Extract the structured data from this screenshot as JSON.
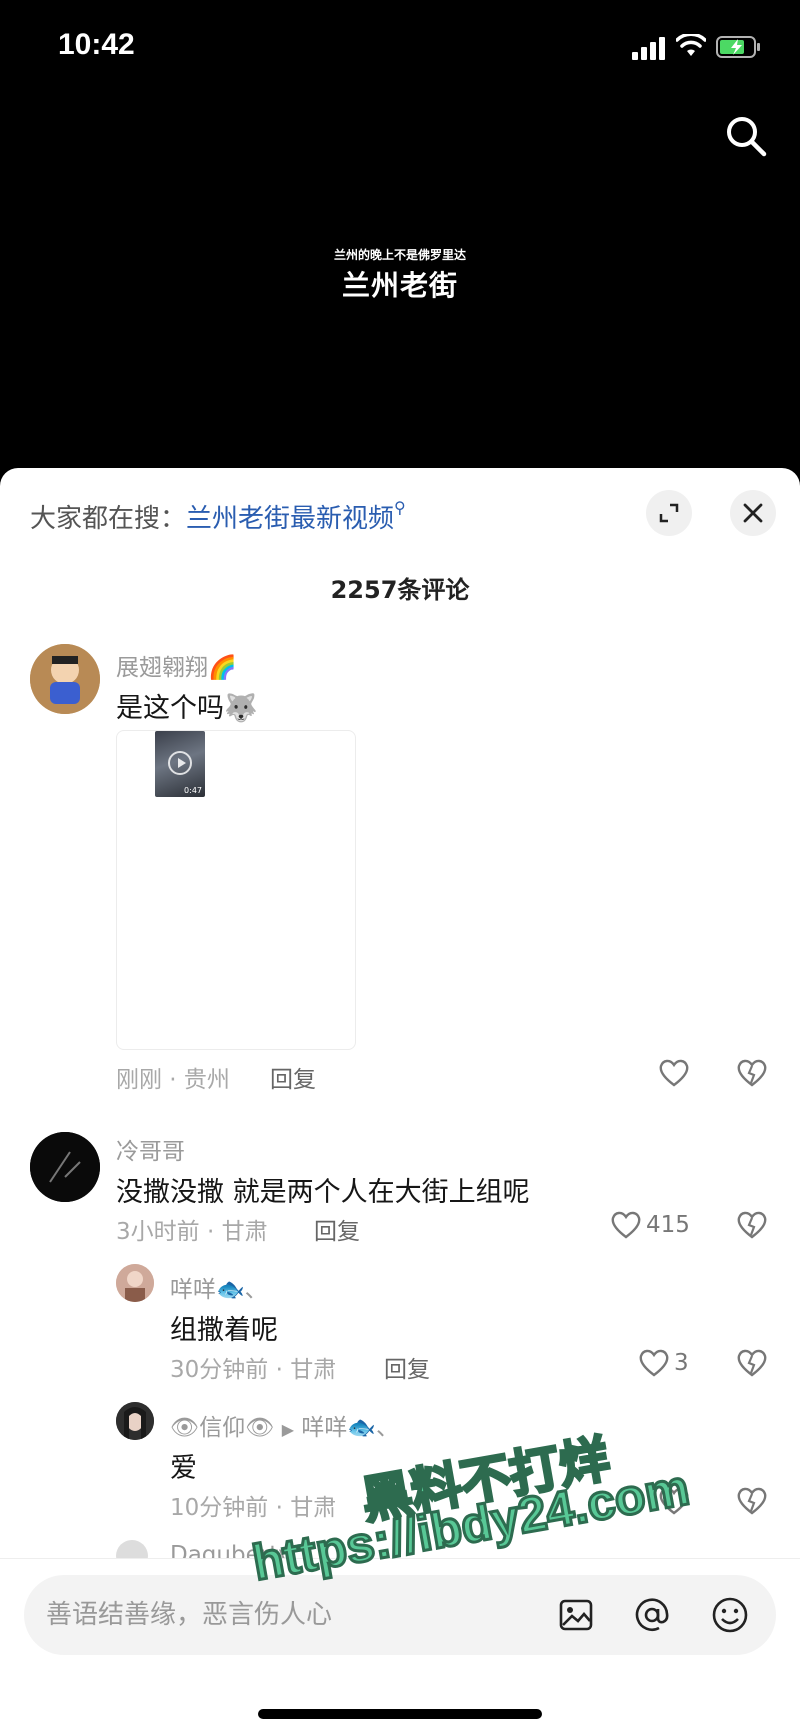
{
  "status_bar": {
    "time": "10:42"
  },
  "video": {
    "subtitle": "兰州的晚上不是佛罗里达",
    "title": "兰州老街"
  },
  "sheet": {
    "search_prefix": "大家都在搜：",
    "search_link": "兰州老街最新视频",
    "comment_count": "2257条评论"
  },
  "comments": [
    {
      "name": "展翅翱翔🌈",
      "text": "是这个吗",
      "emoji": "🐺",
      "meta": "刚刚 · 贵州",
      "reply": "回复",
      "media_duration": "0:47"
    },
    {
      "name": "冷哥哥",
      "text": "没撒没撒 就是两个人在大街上组呢",
      "meta": "3小时前 · 甘肃",
      "reply": "回复",
      "likes": "415"
    }
  ],
  "replies": [
    {
      "name": "咩咩🐟、",
      "text": "组撒着呢",
      "meta": "30分钟前 · 甘肃",
      "reply": "回复",
      "likes": "3"
    },
    {
      "name": "👁信仰👁",
      "reply_to": "咩咩🐟、",
      "text": "爱",
      "meta": "10分钟前 · 甘肃"
    }
  ],
  "peek": {
    "name": "Daguberty"
  },
  "input": {
    "placeholder": "善语结善缘，恶言伤人心"
  },
  "watermark": {
    "line1": "黑料不打烊",
    "line2": "https://ibdy24.com"
  },
  "colors": {
    "link": "#2a5db0",
    "sheet_bg": "#ffffff",
    "video_bg": "#000000",
    "watermark": "#58c896"
  }
}
